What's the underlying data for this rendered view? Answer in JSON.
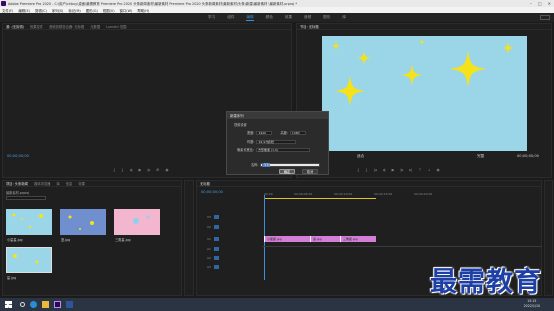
{
  "app": {
    "title": "Adobe Premiere Pro 2020 - C:\\用户\\ckbuy\\桌面\\最需教育 Premiere Pro 2020 头条新闻素材\\最新素材 Premiere Pro 2020 头条新闻素材\\最新素材\\头条\\新建\\最新素材 \\最新素材.prproj *"
  },
  "menu": [
    "文件(F)",
    "编辑(E)",
    "剪辑(C)",
    "序列(S)",
    "标记(M)",
    "图形(G)",
    "视图(V)",
    "窗口(W)",
    "帮助(H)"
  ],
  "workspaces": {
    "items": [
      "学习",
      "组件",
      "编辑",
      "颜色",
      "效果",
      "音频",
      "图形",
      "库"
    ],
    "active": "编辑"
  },
  "source_panel": {
    "tabs": [
      "源: (无剪辑)",
      "效果控件",
      "音频剪辑混合器: 无标题",
      "元数据",
      "Lumetri 范围"
    ],
    "timecode": "00;00;00;00",
    "timecode_right": "00;00;00;00"
  },
  "program_panel": {
    "tab": "节目: 无标题",
    "timecode": "00;00;00;00",
    "fit": "适合",
    "quality": "完整",
    "duration": "00;00;00;00"
  },
  "dialog": {
    "title": "新建序列",
    "group": "视频设置",
    "width_label": "宽度:",
    "width_value": "1920",
    "height_label": "高度:",
    "height_value": "1080",
    "timebase_label": "时基:",
    "timebase_value": "29.97帧/秒",
    "pixel_label": "像素长宽比:",
    "pixel_value": "方形像素 (1.0)",
    "name_label": "名称:",
    "name_value": "序列",
    "ok": "确定",
    "cancel": "取消"
  },
  "project_panel": {
    "tabs": [
      "项目: 头条新闻",
      "媒体浏览器",
      "库",
      "信息",
      "效果"
    ],
    "bin_path": "最新素材.prproj",
    "items": [
      {
        "label": "小星星.jpg",
        "color": "#9ad6e8"
      },
      {
        "label": "蓝.jpg",
        "color": "#6f8fcf"
      },
      {
        "label": "三角星.jpg",
        "color": "#f3b6cf"
      },
      {
        "label": "星.jpg",
        "color": "#9ad6e8"
      }
    ]
  },
  "timeline": {
    "tab": "无标题",
    "timecode": "00;00;00;00",
    "ruler": [
      "00;00",
      "00;00;05;00",
      "00;00;10;00",
      "00;00;15;00",
      "00;00;20;00"
    ],
    "tracks": [
      "V3",
      "V2",
      "V1",
      "A1",
      "A2",
      "A3"
    ],
    "clips": [
      "小星星.jpg",
      "蓝.jpg",
      "三角星.jpg"
    ]
  },
  "taskbar": {
    "time": "15:15",
    "date": "2022/1/10"
  },
  "watermark": "最需教育",
  "colors": {
    "accent": "#3a8fd6",
    "clip": "#d47fd7",
    "sky": "#9ad6e8",
    "star": "#f5e21a"
  }
}
